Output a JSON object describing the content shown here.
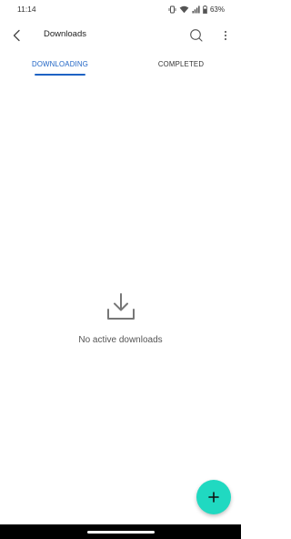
{
  "status_bar": {
    "time": "11:14",
    "battery": "63%",
    "icons": [
      "vibrate-icon",
      "wifi-icon",
      "signal-icon",
      "battery-icon"
    ]
  },
  "app_bar": {
    "title": "Downloads",
    "back_icon": "chevron-left-icon",
    "search_icon": "search-icon",
    "more_icon": "more-vertical-icon"
  },
  "tabs": [
    {
      "label": "DOWNLOADING",
      "active": true
    },
    {
      "label": "COMPLETED",
      "active": false
    }
  ],
  "empty_state": {
    "icon": "download-icon",
    "message": "No active downloads"
  },
  "fab": {
    "icon": "plus-icon"
  },
  "colors": {
    "accent": "#1e63c4",
    "fab": "#20d9c1",
    "nav_bar": "#000000"
  }
}
